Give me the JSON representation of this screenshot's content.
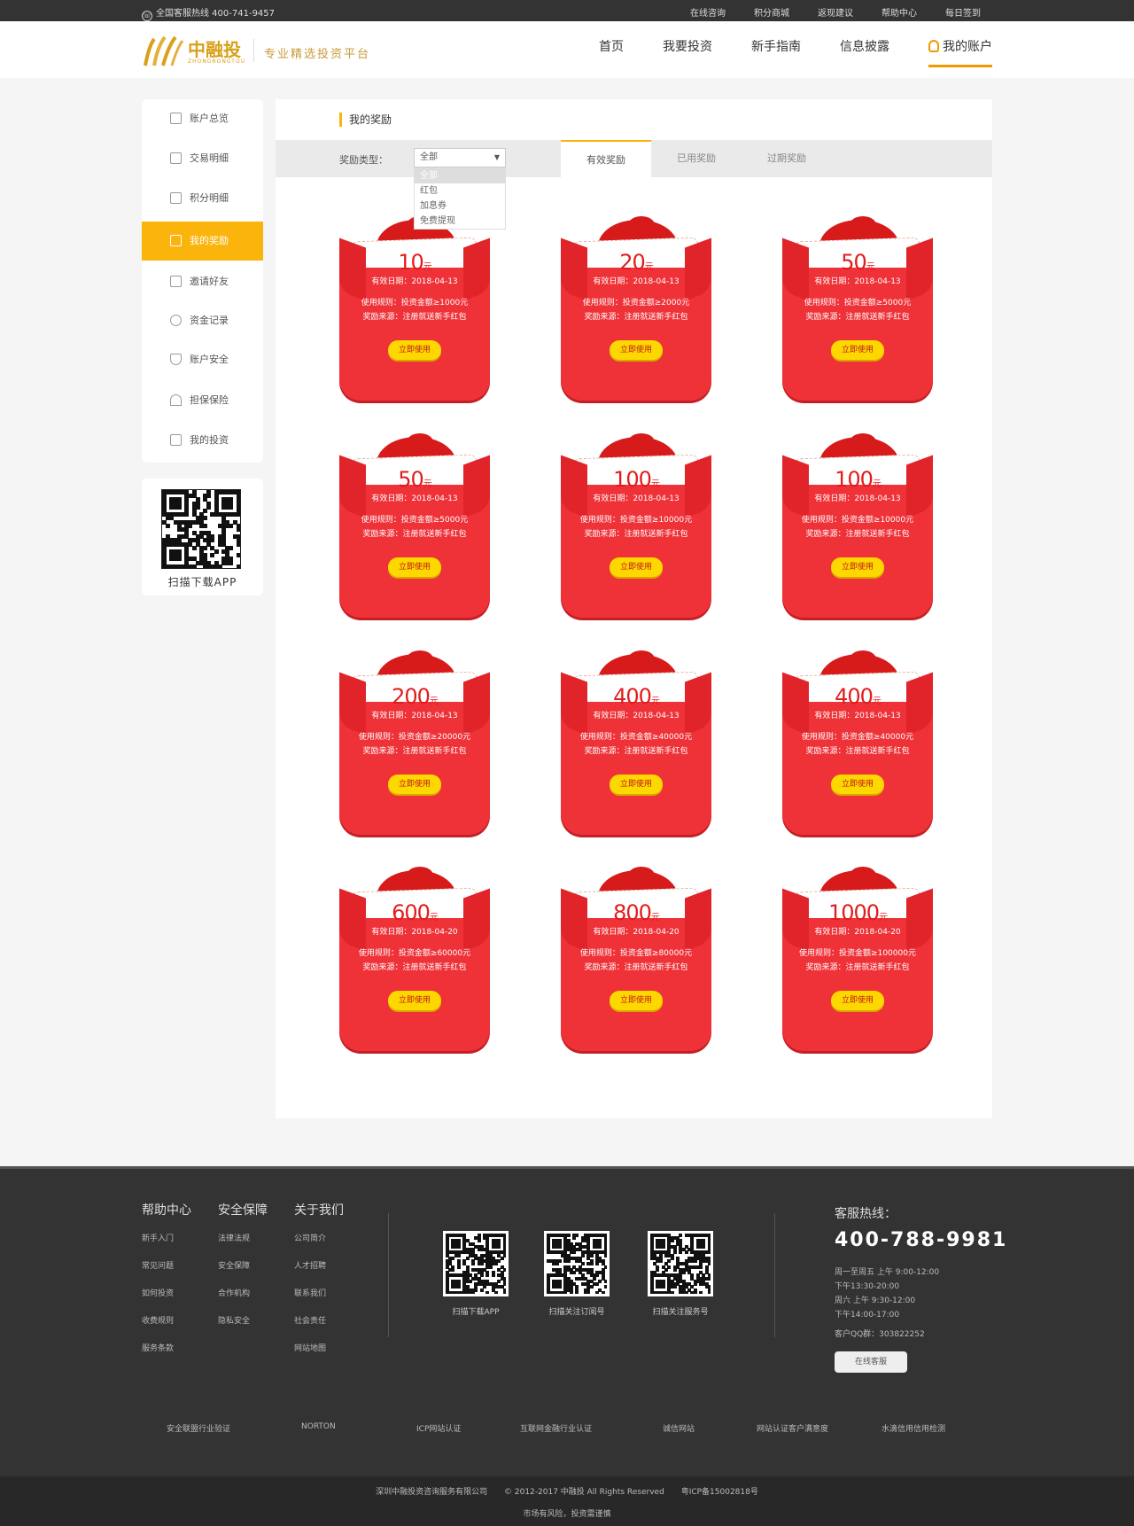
{
  "topbar": {
    "hotline": "全国客服热线 400-741-9457",
    "links": [
      "在线咨询",
      "积分商城",
      "返现建议",
      "帮助中心",
      "每日签到"
    ]
  },
  "header": {
    "brand": "中融投",
    "brand_en": "ZHONGRONGTOU",
    "slogan": "专业精选投资平台",
    "nav": [
      "首页",
      "我要投资",
      "新手指南",
      "信息披露",
      "我的账户"
    ]
  },
  "sidebar": {
    "items": [
      "账户总览",
      "交易明细",
      "积分明细",
      "我的奖励",
      "邀请好友",
      "资金记录",
      "账户安全",
      "担保保险",
      "我的投资"
    ],
    "active_index": 3,
    "qr_label": "扫描下载APP"
  },
  "main": {
    "title": "我的奖励",
    "filter_label": "奖励类型：",
    "select_value": "全部",
    "dropdown_options": [
      "全部",
      "红包",
      "加息券",
      "免费提现"
    ],
    "tabs": [
      "有效奖励",
      "已用奖励",
      "过期奖励"
    ],
    "active_tab": 0
  },
  "rewards": [
    {
      "amount": "10",
      "date": "有效日期：2018-04-13",
      "rule": "使用规则：投资金额≥1000元",
      "source": "奖励来源：注册就送新手红包",
      "button": "立即使用"
    },
    {
      "amount": "20",
      "date": "有效日期：2018-04-13",
      "rule": "使用规则：投资金额≥2000元",
      "source": "奖励来源：注册就送新手红包",
      "button": "立即使用"
    },
    {
      "amount": "50",
      "date": "有效日期：2018-04-13",
      "rule": "使用规则：投资金额≥5000元",
      "source": "奖励来源：注册就送新手红包",
      "button": "立即使用"
    },
    {
      "amount": "50",
      "date": "有效日期：2018-04-13",
      "rule": "使用规则：投资金额≥5000元",
      "source": "奖励来源：注册就送新手红包",
      "button": "立即使用"
    },
    {
      "amount": "100",
      "date": "有效日期：2018-04-13",
      "rule": "使用规则：投资金额≥10000元",
      "source": "奖励来源：注册就送新手红包",
      "button": "立即使用"
    },
    {
      "amount": "100",
      "date": "有效日期：2018-04-13",
      "rule": "使用规则：投资金额≥10000元",
      "source": "奖励来源：注册就送新手红包",
      "button": "立即使用"
    },
    {
      "amount": "200",
      "date": "有效日期：2018-04-13",
      "rule": "使用规则：投资金额≥20000元",
      "source": "奖励来源：注册就送新手红包",
      "button": "立即使用"
    },
    {
      "amount": "400",
      "date": "有效日期：2018-04-13",
      "rule": "使用规则：投资金额≥40000元",
      "source": "奖励来源：注册就送新手红包",
      "button": "立即使用"
    },
    {
      "amount": "400",
      "date": "有效日期：2018-04-13",
      "rule": "使用规则：投资金额≥40000元",
      "source": "奖励来源：注册就送新手红包",
      "button": "立即使用"
    },
    {
      "amount": "600",
      "date": "有效日期：2018-04-20",
      "rule": "使用规则：投资金额≥60000元",
      "source": "奖励来源：注册就送新手红包",
      "button": "立即使用"
    },
    {
      "amount": "800",
      "date": "有效日期：2018-04-20",
      "rule": "使用规则：投资金额≥80000元",
      "source": "奖励来源：注册就送新手红包",
      "button": "立即使用"
    },
    {
      "amount": "1000",
      "date": "有效日期：2018-04-20",
      "rule": "使用规则：投资金额≥100000元",
      "source": "奖励来源：注册就送新手红包",
      "button": "立即使用"
    }
  ],
  "amount_suffix": "元",
  "footer": {
    "columns": [
      {
        "title": "帮助中心",
        "links": [
          "新手入门",
          "常见问题",
          "如何投资",
          "收费规则",
          "服务条款"
        ]
      },
      {
        "title": "安全保障",
        "links": [
          "法律法规",
          "安全保障",
          "合作机构",
          "隐私安全"
        ]
      },
      {
        "title": "关于我们",
        "links": [
          "公司简介",
          "人才招聘",
          "联系我们",
          "社会责任",
          "网站地图"
        ]
      }
    ],
    "qrs": [
      "扫描下载APP",
      "扫描关注订阅号",
      "扫描关注服务号"
    ],
    "service_title": "客服热线：",
    "service_phone": "400-788-9981",
    "hours": [
      "周一至周五 上午 9:00-12:00",
      "下午13:30-20:00",
      "周六 上午 9:30-12:00",
      "下午14:00-17:00"
    ],
    "qq": "客户QQ群：303822252",
    "online_button": "在线客服",
    "certs": [
      "安全联盟行业验证",
      "NORTON",
      "ICP网站认证",
      "互联网金融行业认证",
      "诚信网站",
      "网站认证客户满意度",
      "水滴信用信用检测"
    ],
    "company": "深圳中融投资咨询服务有限公司",
    "copyright": "© 2012-2017 中融投 All Rights Reserved",
    "icp": "粤ICP备15002818号",
    "risk": "市场有风险，投资需谨慎"
  }
}
